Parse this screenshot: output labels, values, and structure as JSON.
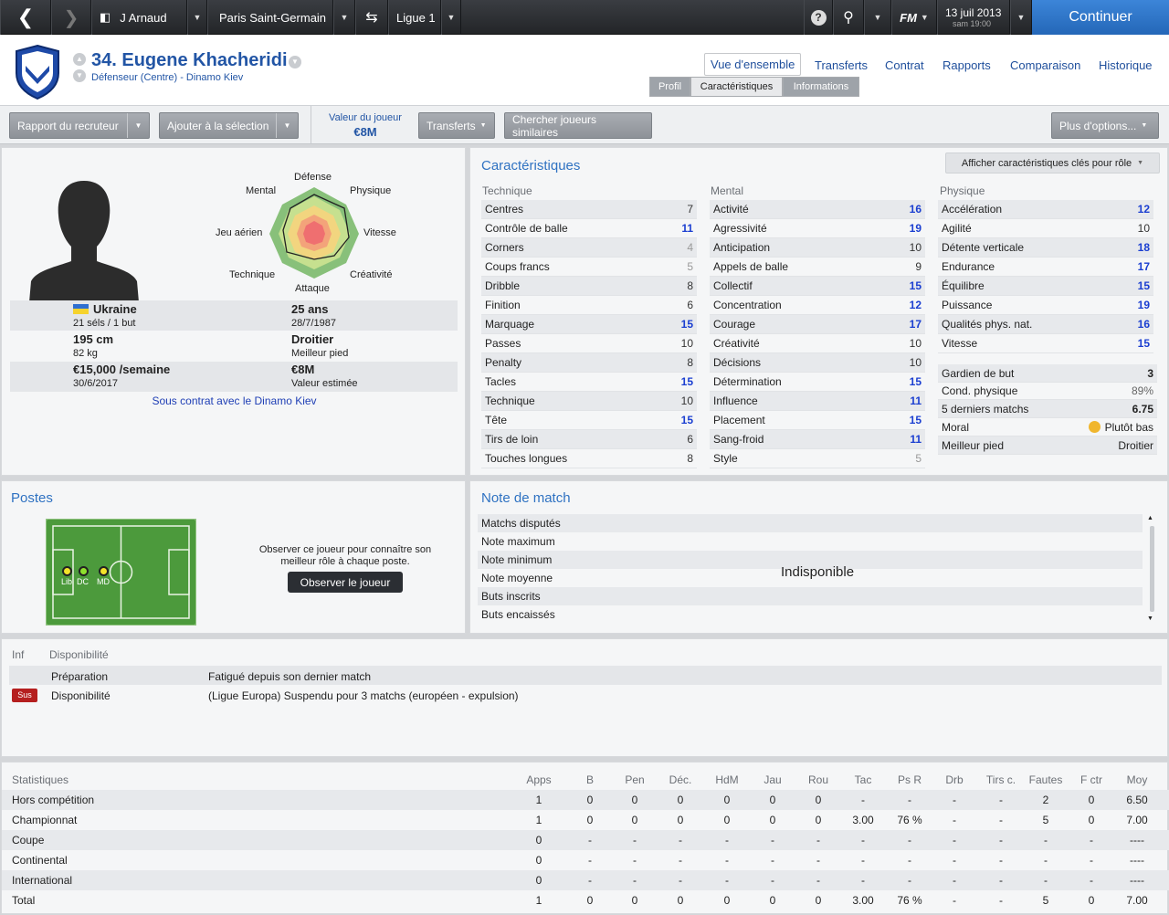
{
  "topbar": {
    "manager": "J Arnaud",
    "club": "Paris Saint-Germain",
    "competition": "Ligue 1",
    "date": "13 juil 2013",
    "time": "sam 19:00",
    "logo": "FM",
    "continue": "Continuer"
  },
  "header": {
    "number_name": "34. Eugene Khacheridi",
    "subtitle": "Défenseur (Centre) - Dinamo Kiev",
    "nav": {
      "overview": "Vue d'ensemble",
      "transfers": "Transferts",
      "contract": "Contrat",
      "reports": "Rapports",
      "comparison": "Comparaison",
      "history": "Historique"
    },
    "subtabs": {
      "profile": "Profil",
      "attributes": "Caractéristiques",
      "information": "Informations"
    }
  },
  "toolbar": {
    "scout_report": "Rapport du recruteur",
    "add_shortlist": "Ajouter à la sélection",
    "value_label": "Valeur du joueur",
    "value": "€8M",
    "transfers": "Transferts",
    "similar": "Chercher joueurs similaires",
    "more": "Plus d'options..."
  },
  "profile": {
    "radar_labels": {
      "defense": "Défense",
      "physical": "Physique",
      "speed": "Vitesse",
      "creativity": "Créativité",
      "attack": "Attaque",
      "technique": "Technique",
      "aerial": "Jeu aérien",
      "mental": "Mental"
    },
    "nationality": "Ukraine",
    "caps": "21 séls / 1 but",
    "age": "25 ans",
    "dob": "28/7/1987",
    "height": "195 cm",
    "weight": "82 kg",
    "foot": "Droitier",
    "foot_label": "Meilleur pied",
    "wage": "€15,000 /semaine",
    "contract_end": "30/6/2017",
    "value": "€8M",
    "value_label": "Valeur estimée",
    "contract_text": "Sous contrat avec le Dinamo Kiev"
  },
  "attributes": {
    "title": "Caractéristiques",
    "button": "Afficher caractéristiques clés pour rôle",
    "technical_header": "Technique",
    "mental_header": "Mental",
    "physical_header": "Physique",
    "technical": [
      [
        "Centres",
        "7",
        "md"
      ],
      [
        "Contrôle de balle",
        "11",
        "hi"
      ],
      [
        "Corners",
        "4",
        "lo"
      ],
      [
        "Coups francs",
        "5",
        "lo"
      ],
      [
        "Dribble",
        "8",
        "md"
      ],
      [
        "Finition",
        "6",
        "md"
      ],
      [
        "Marquage",
        "15",
        "hi"
      ],
      [
        "Passes",
        "10",
        "md"
      ],
      [
        "Penalty",
        "8",
        "md"
      ],
      [
        "Tacles",
        "15",
        "hi"
      ],
      [
        "Technique",
        "10",
        "md"
      ],
      [
        "Tête",
        "15",
        "hi"
      ],
      [
        "Tirs de loin",
        "6",
        "md"
      ],
      [
        "Touches longues",
        "8",
        "md"
      ]
    ],
    "mental": [
      [
        "Activité",
        "16",
        "hi"
      ],
      [
        "Agressivité",
        "19",
        "hi"
      ],
      [
        "Anticipation",
        "10",
        "md"
      ],
      [
        "Appels de balle",
        "9",
        "md"
      ],
      [
        "Collectif",
        "15",
        "hi"
      ],
      [
        "Concentration",
        "12",
        "hi"
      ],
      [
        "Courage",
        "17",
        "hi"
      ],
      [
        "Créativité",
        "10",
        "md"
      ],
      [
        "Décisions",
        "10",
        "md"
      ],
      [
        "Détermination",
        "15",
        "hi"
      ],
      [
        "Influence",
        "11",
        "hi"
      ],
      [
        "Placement",
        "15",
        "hi"
      ],
      [
        "Sang-froid",
        "11",
        "hi"
      ],
      [
        "Style",
        "5",
        "lo"
      ]
    ],
    "physical": [
      [
        "Accélération",
        "12",
        "hi"
      ],
      [
        "Agilité",
        "10",
        "md"
      ],
      [
        "Détente verticale",
        "18",
        "hi"
      ],
      [
        "Endurance",
        "17",
        "hi"
      ],
      [
        "Équilibre",
        "15",
        "hi"
      ],
      [
        "Puissance",
        "19",
        "hi"
      ],
      [
        "Qualités phys. nat.",
        "16",
        "hi"
      ],
      [
        "Vitesse",
        "15",
        "hi"
      ]
    ],
    "extra": [
      [
        "Gardien de but",
        "3"
      ],
      [
        "Cond. physique",
        "89%"
      ],
      [
        "5 derniers matchs",
        "6.75"
      ],
      [
        "Moral",
        "Plutôt bas"
      ],
      [
        "Meilleur pied",
        "Droitier"
      ]
    ]
  },
  "positions": {
    "title": "Postes",
    "text": "Observer ce joueur pour connaître son meilleur rôle à chaque poste.",
    "button": "Observer le joueur",
    "markers": [
      "Lib",
      "DC",
      "MD"
    ]
  },
  "match_rating": {
    "title": "Note de match",
    "rows": [
      "Matchs disputés",
      "Note maximum",
      "Note minimum",
      "Note moyenne",
      "Buts inscrits",
      "Buts encaissés"
    ],
    "unavailable": "Indisponible"
  },
  "availability": {
    "col1": "Inf",
    "col2": "Disponibilité",
    "rows": [
      {
        "badge": "",
        "type": "Préparation",
        "desc": "Fatigué depuis son dernier match"
      },
      {
        "badge": "Sus",
        "type": "Disponibilité",
        "desc": "(Ligue Europa) Suspendu pour 3 matchs (européen - expulsion)"
      }
    ]
  },
  "stats": {
    "headers": [
      "Statistiques",
      "Apps",
      "B",
      "Pen",
      "Déc.",
      "HdM",
      "Jau",
      "Rou",
      "Tac",
      "Ps R",
      "Drb",
      "Tirs c.",
      "Fautes",
      "F ctr",
      "Moy"
    ],
    "rows": [
      [
        "Hors compétition",
        "1",
        "0",
        "0",
        "0",
        "0",
        "0",
        "0",
        "-",
        "-",
        "-",
        "-",
        "2",
        "0",
        "6.50"
      ],
      [
        "Championnat",
        "1",
        "0",
        "0",
        "0",
        "0",
        "0",
        "0",
        "3.00",
        "76 %",
        "-",
        "-",
        "5",
        "0",
        "7.00"
      ],
      [
        "Coupe",
        "0",
        "-",
        "-",
        "-",
        "-",
        "-",
        "-",
        "-",
        "-",
        "-",
        "-",
        "-",
        "-",
        "----"
      ],
      [
        "Continental",
        "0",
        "-",
        "-",
        "-",
        "-",
        "-",
        "-",
        "-",
        "-",
        "-",
        "-",
        "-",
        "-",
        "----"
      ],
      [
        "International",
        "0",
        "-",
        "-",
        "-",
        "-",
        "-",
        "-",
        "-",
        "-",
        "-",
        "-",
        "-",
        "-",
        "----"
      ],
      [
        "Total",
        "1",
        "0",
        "0",
        "0",
        "0",
        "0",
        "0",
        "3.00",
        "76 %",
        "-",
        "-",
        "5",
        "0",
        "7.00"
      ]
    ]
  }
}
